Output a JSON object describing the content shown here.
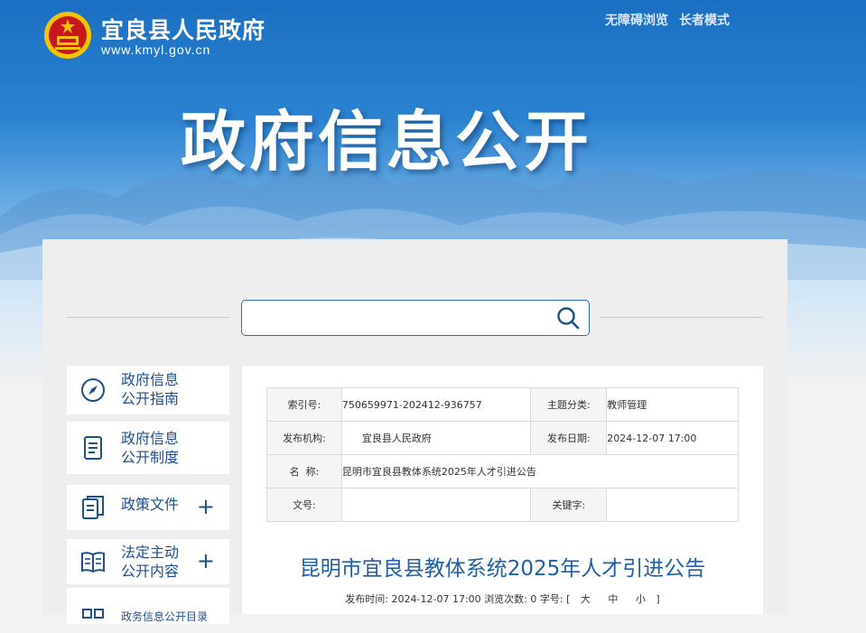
{
  "header": {
    "site_title": "宜良县人民政府",
    "site_url": "www.kmyl.gov.cn",
    "links": [
      "无障碍浏览",
      "长者模式"
    ],
    "banner_title": "政府信息公开"
  },
  "search": {
    "value": "",
    "placeholder": ""
  },
  "sidebar": {
    "items": [
      {
        "label_line1": "政府信息",
        "label_line2": "公开指南",
        "icon": "compass-icon",
        "expandable": false
      },
      {
        "label_line1": "政府信息",
        "label_line2": "公开制度",
        "icon": "document-icon",
        "expandable": false
      },
      {
        "label_line1": "政策文件",
        "label_line2": "",
        "icon": "files-icon",
        "expandable": true
      },
      {
        "label_line1": "法定主动",
        "label_line2": "公开内容",
        "icon": "book-icon",
        "expandable": true
      },
      {
        "label_line1": "政务信息公开目录",
        "label_line2": "",
        "icon": "grid-icon",
        "expandable": false
      }
    ],
    "plus_glyph": "+"
  },
  "meta_table": {
    "index_label": "索引号:",
    "index_value": "750659971-202412-936757",
    "topic_label": "主题分类:",
    "topic_value": "教师管理",
    "org_label": "发布机构:",
    "org_value": "宜良县人民政府",
    "date_label": "发布日期:",
    "date_value": "2024-12-07 17:00",
    "name_label": "名  称:",
    "name_value": "昆明市宜良县教体系统2025年人才引进公告",
    "docno_label": "文号:",
    "docno_value": "",
    "keywords_label": "关键字:",
    "keywords_value": ""
  },
  "article": {
    "title": "昆明市宜良县教体系统2025年人才引进公告",
    "publish_label": "发布时间:",
    "publish_time": "2024-12-07 17:00",
    "views_label": "浏览次数:",
    "views": "0",
    "fontsize_label": "字号:",
    "bracket_open": "[",
    "bracket_close": "]",
    "font_large": "大",
    "font_medium": "中",
    "font_small": "小"
  },
  "colors": {
    "accent": "#1f5fa8",
    "banner": "#1b6fc2",
    "emblem_red": "#c8161d",
    "emblem_gold": "#f5c400"
  }
}
